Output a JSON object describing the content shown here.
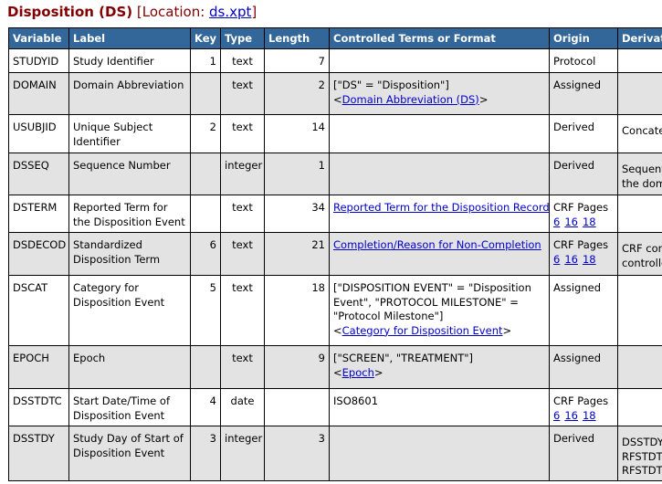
{
  "heading": {
    "dataset": "Disposition (DS)",
    "location_prefix": "[Location: ",
    "file": "ds.xpt",
    "location_suffix": "]"
  },
  "columns": [
    "Variable",
    "Label",
    "Key",
    "Type",
    "Length",
    "Controlled Terms or Format",
    "Origin",
    "Derivation"
  ],
  "rows": [
    {
      "variable": "STUDYID",
      "label": "Study Identifier",
      "key": "1",
      "type": "text",
      "length": "7",
      "ct_text": "",
      "ct_link": "",
      "origin": "Protocol",
      "pages": [],
      "derivation": ""
    },
    {
      "variable": "DOMAIN",
      "label": "Domain Abbreviation",
      "key": "",
      "type": "text",
      "length": "2",
      "ct_text": "[\"DS\" = \"Disposition\"]",
      "ct_link": "Domain Abbreviation (DS)",
      "origin": "Assigned",
      "pages": [],
      "derivation": ""
    },
    {
      "variable": "USUBJID",
      "label": "Unique Subject Identifier",
      "key": "2",
      "type": "text",
      "length": "14",
      "ct_text": "",
      "ct_link": "",
      "origin": "Derived",
      "pages": [],
      "derivation": "Concatena"
    },
    {
      "variable": "DSSEQ",
      "label": "Sequence Number",
      "key": "",
      "type": "integer",
      "length": "1",
      "ct_text": "",
      "ct_link": "",
      "origin": "Derived",
      "pages": [],
      "derivation": "Sequential in the dom"
    },
    {
      "variable": "DSTERM",
      "label": "Reported Term for the Disposition Event",
      "key": "",
      "type": "text",
      "length": "34",
      "ct_text": "",
      "ct_link": "Reported Term for the Disposition Record",
      "origin": "CRF Pages",
      "pages": [
        "6",
        "16",
        "18"
      ],
      "derivation": ""
    },
    {
      "variable": "DSDECOD",
      "label": "Standardized Disposition Term",
      "key": "6",
      "type": "text",
      "length": "21",
      "ct_text": "",
      "ct_link": "Completion/Reason for Non-Completion",
      "origin": "CRF Pages",
      "pages": [
        "6",
        "16",
        "18"
      ],
      "derivation": "CRF contro controlled"
    },
    {
      "variable": "DSCAT",
      "label": "Category for Disposition Event",
      "key": "5",
      "type": "text",
      "length": "18",
      "ct_text": "[\"DISPOSITION EVENT\" = \"Disposition Event\", \"PROTOCOL MILESTONE\" = \"Protocol Milestone\"]",
      "ct_link": "Category for Disposition Event",
      "origin": "Assigned",
      "pages": [],
      "derivation": ""
    },
    {
      "variable": "EPOCH",
      "label": "Epoch",
      "key": "",
      "type": "text",
      "length": "9",
      "ct_text": "[\"SCREEN\", \"TREATMENT\"]",
      "ct_link": "Epoch",
      "origin": "Assigned",
      "pages": [],
      "derivation": ""
    },
    {
      "variable": "DSSTDTC",
      "label": "Start Date/Time of Disposition Event",
      "key": "4",
      "type": "date",
      "length": "",
      "ct_text": "ISO8601",
      "ct_link": "",
      "origin": "CRF Pages",
      "pages": [
        "6",
        "16",
        "18"
      ],
      "derivation": ""
    },
    {
      "variable": "DSSTDY",
      "label": "Study Day of Start of Disposition Event",
      "key": "3",
      "type": "integer",
      "length": "3",
      "ct_text": "",
      "ct_link": "",
      "origin": "Derived",
      "pages": [],
      "derivation": "DSSTDY = RFSTDTC. RFSTDTC."
    }
  ]
}
